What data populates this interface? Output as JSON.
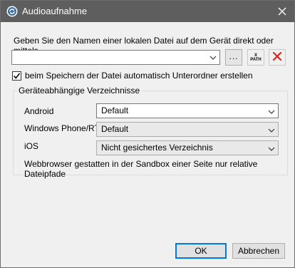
{
  "window": {
    "title": "Audioaufnahme",
    "app_icon": "altova-mobile-icon",
    "close_icon": "close-icon"
  },
  "prompt": "Geben Sie den Namen einer lokalen Datei auf dem Gerät direkt oder mittels",
  "file_input": {
    "value": "",
    "dropdown_icon": "chevron-down-icon"
  },
  "toolbar": {
    "browse_label": "...",
    "xpath_top": "X",
    "xpath_bottom": "PATH",
    "delete_icon": "red-x-icon"
  },
  "auto_subfolder": {
    "label": "beim Speichern der Datei automatisch Unterordner erstellen",
    "checked": true
  },
  "group": {
    "title": "Geräteabhängige Verzeichnisse",
    "rows": [
      {
        "label": "Android",
        "value": "Default"
      },
      {
        "label": "Windows Phone/RT",
        "value": "Default"
      },
      {
        "label": "iOS",
        "value": "Nicht gesichertes Verzeichnis"
      }
    ],
    "note": "Webbrowser gestatten in der Sandbox einer Seite nur relative Dateipfade"
  },
  "buttons": {
    "ok": "OK",
    "cancel": "Abbrechen"
  },
  "colors": {
    "titlebar": "#5e5e5e",
    "delete_red": "#d9231e",
    "focus_blue": "#0078d7"
  }
}
